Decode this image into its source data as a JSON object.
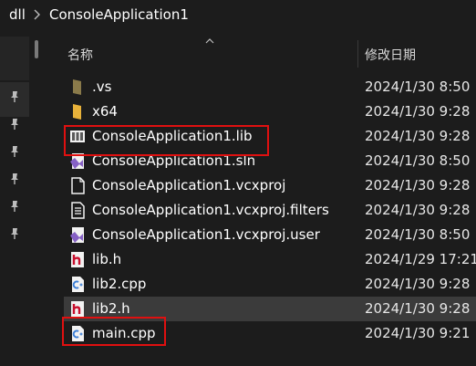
{
  "breadcrumb": {
    "items": [
      "dll",
      "ConsoleApplication1"
    ],
    "separator_icon": "chevron-right-icon"
  },
  "columns": {
    "name": "名称",
    "date_modified": "修改日期"
  },
  "files": [
    {
      "name": ".vs",
      "date": "2024/1/30 8:50",
      "icon": "folder-hidden-icon"
    },
    {
      "name": "x64",
      "date": "2024/1/30 9:28",
      "icon": "folder-icon"
    },
    {
      "name": "ConsoleApplication1.lib",
      "date": "2024/1/30 9:28",
      "icon": "library-file-icon"
    },
    {
      "name": "ConsoleApplication1.sln",
      "date": "2024/1/30 8:50",
      "icon": "visual-studio-solution-icon"
    },
    {
      "name": "ConsoleApplication1.vcxproj",
      "date": "2024/1/30 9:28",
      "icon": "project-file-icon"
    },
    {
      "name": "ConsoleApplication1.vcxproj.filters",
      "date": "2024/1/30 9:28",
      "icon": "filters-file-icon"
    },
    {
      "name": "ConsoleApplication1.vcxproj.user",
      "date": "2024/1/30 8:50",
      "icon": "vs-user-file-icon"
    },
    {
      "name": "lib.h",
      "date": "2024/1/29 17:21",
      "icon": "header-file-icon"
    },
    {
      "name": "lib2.cpp",
      "date": "2024/1/30 9:28",
      "icon": "cpp-file-icon"
    },
    {
      "name": "lib2.h",
      "date": "2024/1/30 9:28",
      "icon": "header-file-icon"
    },
    {
      "name": "main.cpp",
      "date": "2024/1/30 9:21",
      "icon": "cpp-file-icon"
    }
  ],
  "selected_file": "lib2.h",
  "highlighted_files": [
    "ConsoleApplication1.lib",
    "main.cpp"
  ],
  "colors": {
    "background": "#1c1c1c",
    "selection": "#3b3b3b",
    "annotation_red": "#e01010",
    "folder_yellow": "#e8b23a",
    "header_red": "#c8102e",
    "cpp_blue": "#3c7fd6",
    "vs_purple": "#8661c5"
  }
}
